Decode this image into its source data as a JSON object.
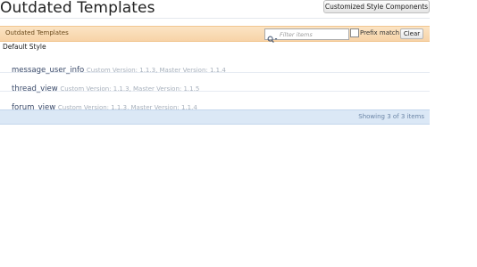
{
  "page": {
    "title": "Outdated Templates",
    "customized_button": "Customized Style Components"
  },
  "filter": {
    "section_label": "Outdated Templates",
    "search_placeholder": "Filter items",
    "search_value": "",
    "search_icon": "search-icon",
    "prefix_match_label": "Prefix match",
    "prefix_match_checked": false,
    "clear_label": "Clear"
  },
  "group": {
    "label": "Default Style"
  },
  "templates": [
    {
      "name": "message_user_info",
      "meta": "Custom Version: 1.1.3, Master Version: 1.1.4"
    },
    {
      "name": "thread_view",
      "meta": "Custom Version: 1.1.3, Master Version: 1.1.5"
    },
    {
      "name": "forum_view",
      "meta": "Custom Version: 1.1.3, Master Version: 1.1.4"
    }
  ],
  "footer": {
    "summary": "Showing 3 of 3 items"
  },
  "colors": {
    "filter_bar": "#f7d3a7",
    "footer_bar": "#dbe8f6",
    "template_name": "#3a4a6a",
    "template_meta": "#a7b0bc"
  }
}
